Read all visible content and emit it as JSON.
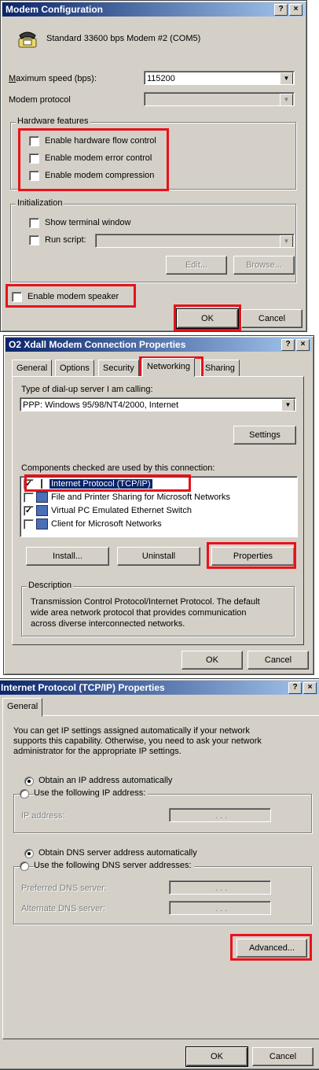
{
  "modem": {
    "title": "Modem Configuration",
    "help": "?",
    "close": "×",
    "device_name": "Standard 33600 bps Modem #2 (COM5)",
    "max_speed_label": "Maximum speed (bps):",
    "max_speed_value": "115200",
    "protocol_label": "Modem protocol",
    "protocol_value": "",
    "hw_group": "Hardware features",
    "hw_flow": "Enable hardware flow control",
    "error_control": "Enable modem error control",
    "compression": "Enable modem compression",
    "init_group": "Initialization",
    "show_terminal": "Show terminal window",
    "run_script": "Run script:",
    "edit": "Edit...",
    "browse": "Browse...",
    "speaker": "Enable modem speaker",
    "ok": "OK",
    "cancel": "Cancel"
  },
  "conn": {
    "title": "O2 Xdall Modem Connection Properties",
    "help": "?",
    "close": "×",
    "tabs": [
      "General",
      "Options",
      "Security",
      "Networking",
      "Sharing"
    ],
    "server_label": "Type of dial-up server I am calling:",
    "server_value": "PPP: Windows 95/98/NT4/2000, Internet",
    "settings": "Settings",
    "components_label": "Components checked are used by this connection:",
    "components": [
      {
        "label": "Internet Protocol (TCP/IP)",
        "checked": true
      },
      {
        "label": "File and Printer Sharing for Microsoft Networks",
        "checked": false
      },
      {
        "label": "Virtual PC Emulated Ethernet Switch",
        "checked": true
      },
      {
        "label": "Client for Microsoft Networks",
        "checked": false
      }
    ],
    "install": "Install...",
    "uninstall": "Uninstall",
    "properties": "Properties",
    "desc_group": "Description",
    "desc_line1": "Transmission Control Protocol/Internet Protocol. The default",
    "desc_line2": "wide area network protocol that provides communication",
    "desc_line3": "across diverse interconnected networks.",
    "ok": "OK",
    "cancel": "Cancel"
  },
  "tcp": {
    "title": "Internet Protocol (TCP/IP) Properties",
    "help": "?",
    "close": "×",
    "tab": "General",
    "intro_line1": "You can get IP settings assigned automatically if your network",
    "intro_line2": "supports this capability. Otherwise, you need to ask your network",
    "intro_line3": "administrator for the appropriate IP settings.",
    "obtain_ip": "Obtain an IP address automatically",
    "use_ip": "Use the following IP address:",
    "ip_label": "IP address:",
    "obtain_dns": "Obtain DNS server address automatically",
    "use_dns": "Use the following DNS server addresses:",
    "pref_dns": "Preferred DNS server:",
    "alt_dns": "Alternate DNS server:",
    "dots": ".     .     .",
    "advanced": "Advanced...",
    "ok": "OK",
    "cancel": "Cancel"
  },
  "colors": {
    "highlight": "#e8121b",
    "titlebar": "#0a246a",
    "face": "#d4d0c8"
  }
}
